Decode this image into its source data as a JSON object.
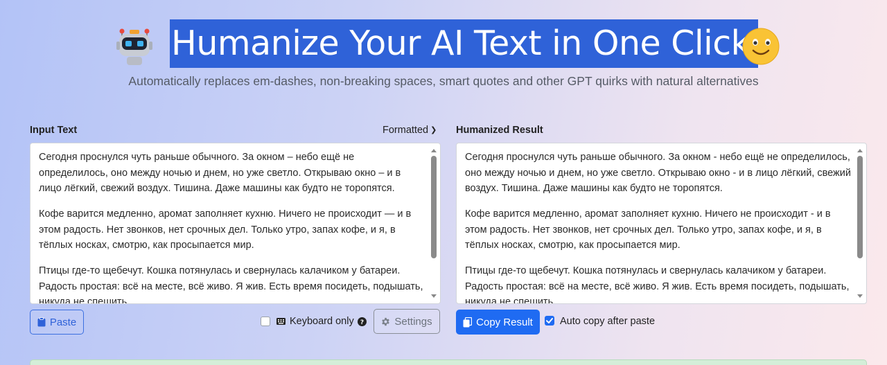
{
  "header": {
    "title": "Humanize Your AI Text in One Click",
    "subtitle": "Automatically replaces em-dashes, non-breaking spaces, smart quotes and other GPT quirks with natural alternatives",
    "left_icon": "robot-emoji",
    "right_icon": "smiley-emoji"
  },
  "input": {
    "label": "Input Text",
    "format_selector": "Formatted",
    "paragraphs": [
      "Сегодня проснулся чуть раньше обычного. За окном – небо ещё не определилось, оно между ночью и днем, но уже светло. Открываю окно – и в лицо лёгкий, свежий воздух. Тишина. Даже машины как будто не торопятся.",
      "Кофе варится медленно, аромат заполняет кухню. Ничего не происходит — и в этом радость. Нет звонков, нет срочных дел. Только утро, запах кофе, и я, в тёплых носках, смотрю, как просыпается мир.",
      "Птицы где-то щебечут. Кошка потянулась и свернулась калачиком у батареи. Радость простая: всё на месте, всё живо. Я жив. Есть время посидеть, подышать, никуда не спешить."
    ],
    "paste_label": "Paste",
    "keyboard_only_label": "Keyboard only",
    "keyboard_only_checked": false,
    "settings_label": "Settings"
  },
  "output": {
    "label": "Humanized Result",
    "paragraphs": [
      "Сегодня проснулся чуть раньше обычного. За окном - небо ещё не определилось, оно между ночью и днем, но уже светло. Открываю окно - и в лицо лёгкий, свежий воздух. Тишина. Даже машины как будто не торопятся.",
      "Кофе варится медленно, аромат заполняет кухню. Ничего не происходит - и в этом радость. Нет звонков, нет срочных дел. Только утро, запах кофе, и я, в тёплых носках, смотрю, как просыпается мир.",
      "Птицы где-то щебечут. Кошка потянулась и свернулась калачиком у батареи. Радость простая: всё на месте, всё живо. Я жив. Есть время посидеть, подышать, никуда не спешить."
    ],
    "copy_label": "Copy Result",
    "auto_copy_label": "Auto copy after paste",
    "auto_copy_checked": true
  },
  "colors": {
    "accent": "#1f6bf2",
    "title_highlight": "#2f62d8",
    "success_alert": "#d4eed8"
  }
}
